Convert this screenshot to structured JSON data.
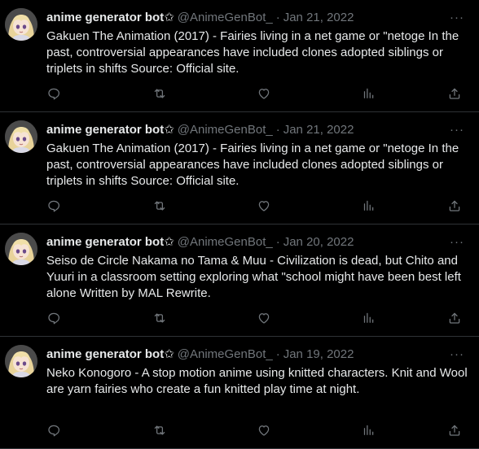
{
  "colors": {
    "background": "#000000",
    "text": "#e7e9ea",
    "muted": "#71767b",
    "divider": "#2f3336"
  },
  "tweets": [
    {
      "name": "anime generator bot✩",
      "handle": "@AnimeGenBot_",
      "separator": "·",
      "date": "Jan 21, 2022",
      "text": "Gakuen The Animation (2017) - Fairies living in a net game or \"netoge In the past, controversial appearances have included clones adopted siblings or triplets in shifts Source: Official site.",
      "more": "···"
    },
    {
      "name": "anime generator bot✩",
      "handle": "@AnimeGenBot_",
      "separator": "·",
      "date": "Jan 21, 2022",
      "text": "Gakuen The Animation (2017) - Fairies living in a net game or \"netoge In the past, controversial appearances have included clones adopted siblings or triplets in shifts Source: Official site.",
      "more": "···"
    },
    {
      "name": "anime generator bot✩",
      "handle": "@AnimeGenBot_",
      "separator": "·",
      "date": "Jan 20, 2022",
      "text": "Seiso de Circle Nakama no Tama & Muu - Civilization is dead, but Chito and Yuuri in a classroom setting exploring what \"school might have been best left alone Written by MAL Rewrite.",
      "more": "···"
    },
    {
      "name": "anime generator bot✩",
      "handle": "@AnimeGenBot_",
      "separator": "·",
      "date": "Jan 19, 2022",
      "text": "Neko Konogoro - A stop motion anime using knitted characters. Knit and Wool are yarn fairies who create a fun knitted play time at night.",
      "more": "···"
    }
  ],
  "action_icons": [
    "reply-icon",
    "retweet-icon",
    "like-icon",
    "views-icon",
    "share-icon"
  ]
}
